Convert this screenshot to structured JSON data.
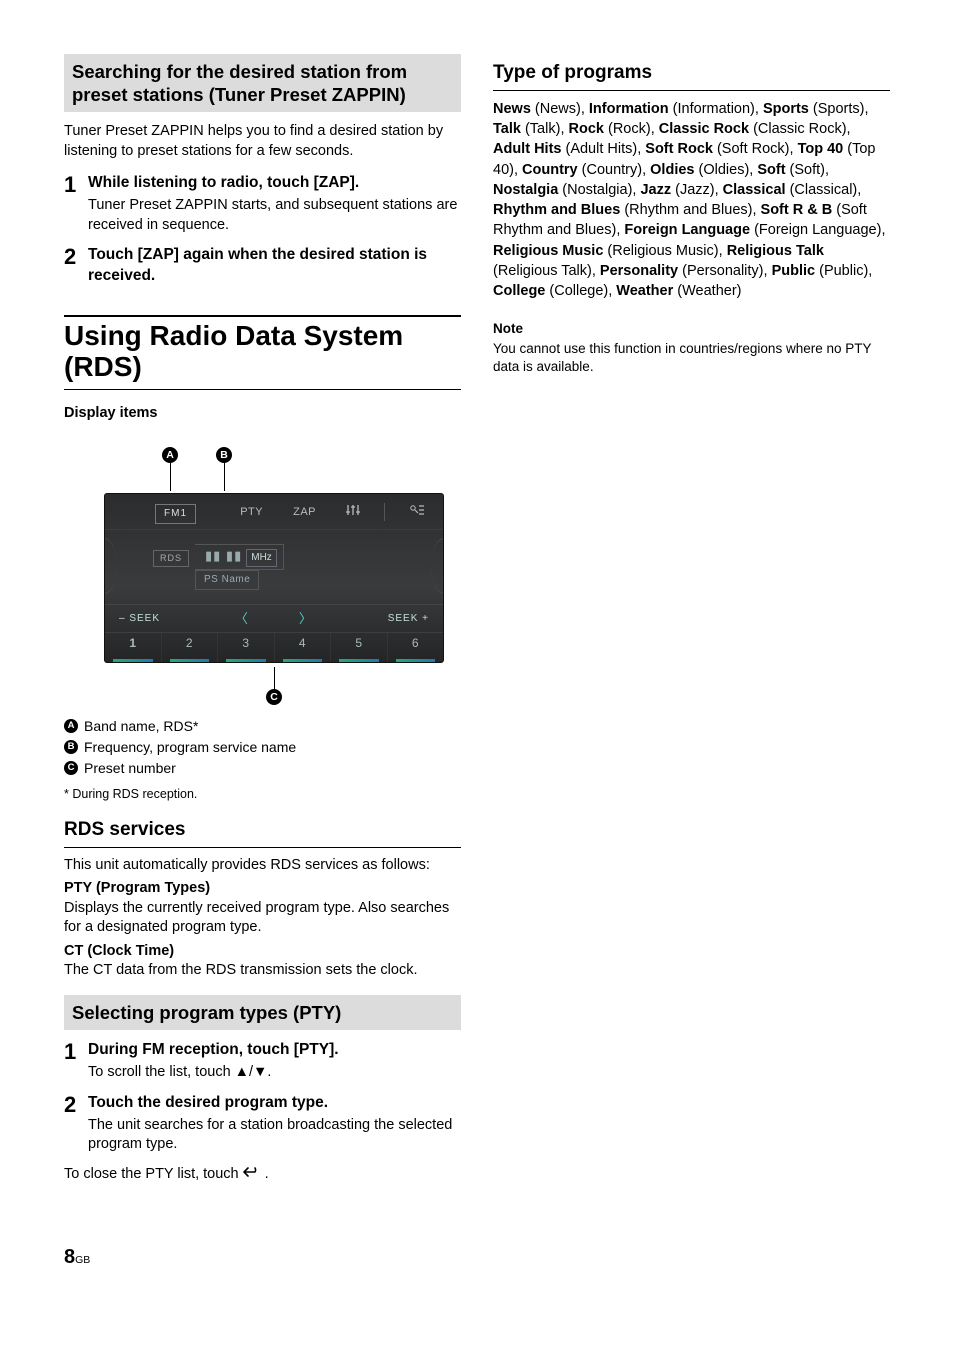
{
  "left": {
    "box1_title": "Searching for the desired station from preset stations (Tuner Preset ZAPPIN)",
    "box1_intro": "Tuner Preset ZAPPIN helps you to find a desired station by listening to preset stations for a few seconds.",
    "box1_steps": [
      {
        "n": "1",
        "head": "While listening to radio, touch [ZAP].",
        "desc": "Tuner Preset ZAPPIN starts, and subsequent stations are received in sequence."
      },
      {
        "n": "2",
        "head": "Touch [ZAP] again when the desired station is received.",
        "desc": ""
      }
    ],
    "h1": "Using Radio Data System (RDS)",
    "display_items": "Display items",
    "callouts": {
      "a": "A",
      "b": "B",
      "c": "C"
    },
    "screen": {
      "band": "FM1",
      "pty": "PTY",
      "zap": "ZAP",
      "rds": "RDS",
      "freq_digits": "▮▮ ▮▮",
      "mhz": "MHz",
      "ps": "PS Name",
      "seek_minus": "– SEEK",
      "seek_plus": "SEEK +",
      "presets": [
        "1",
        "2",
        "3",
        "4",
        "5",
        "6"
      ]
    },
    "legend": [
      {
        "dot": "A",
        "txt": "Band name, RDS*"
      },
      {
        "dot": "B",
        "txt": "Frequency, program service name"
      },
      {
        "dot": "C",
        "txt": "Preset number"
      }
    ],
    "footnote": "* During RDS reception.",
    "rds_h": "RDS services",
    "rds_intro": "This unit automatically provides RDS services as follows:",
    "rds_pty_h": "PTY (Program Types)",
    "rds_pty_b": "Displays the currently received program type. Also searches for a designated program type.",
    "rds_ct_h": "CT (Clock Time)",
    "rds_ct_b": "The CT data from the RDS transmission sets the clock.",
    "box2_title": "Selecting program types (PTY)",
    "box2_steps": [
      {
        "n": "1",
        "head": "During FM reception, touch [PTY].",
        "desc": "To scroll the list, touch ▲/▼."
      },
      {
        "n": "2",
        "head": "Touch the desired program type.",
        "desc": "The unit searches for a station broadcasting the selected program type."
      }
    ],
    "close_pre": "To close the PTY list, touch ",
    "close_post": "."
  },
  "right": {
    "h": "Type of programs",
    "items": [
      {
        "b": "News",
        "p": "News"
      },
      {
        "b": "Information",
        "p": "Information"
      },
      {
        "b": "Sports",
        "p": "Sports"
      },
      {
        "b": "Talk",
        "p": "Talk"
      },
      {
        "b": "Rock",
        "p": "Rock"
      },
      {
        "b": "Classic Rock",
        "p": "Classic Rock"
      },
      {
        "b": "Adult Hits",
        "p": "Adult Hits"
      },
      {
        "b": "Soft Rock",
        "p": "Soft Rock"
      },
      {
        "b": "Top 40",
        "p": "Top 40"
      },
      {
        "b": "Country",
        "p": "Country"
      },
      {
        "b": "Oldies",
        "p": "Oldies"
      },
      {
        "b": "Soft",
        "p": "Soft"
      },
      {
        "b": "Nostalgia",
        "p": "Nostalgia"
      },
      {
        "b": "Jazz",
        "p": "Jazz"
      },
      {
        "b": "Classical",
        "p": "Classical"
      },
      {
        "b": "Rhythm and Blues",
        "p": "Rhythm and Blues"
      },
      {
        "b": "Soft R & B",
        "p": "Soft Rhythm and Blues"
      },
      {
        "b": "Foreign Language",
        "p": "Foreign Language"
      },
      {
        "b": "Religious Music",
        "p": "Religious Music"
      },
      {
        "b": "Religious Talk",
        "p": "Religious Talk"
      },
      {
        "b": "Personality",
        "p": "Personality"
      },
      {
        "b": "Public",
        "p": "Public"
      },
      {
        "b": "College",
        "p": "College"
      },
      {
        "b": "Weather",
        "p": "Weather"
      }
    ],
    "note_h": "Note",
    "note_b": "You cannot use this function in countries/regions where no PTY data is available."
  },
  "page": {
    "num": "8",
    "lang": "GB"
  }
}
